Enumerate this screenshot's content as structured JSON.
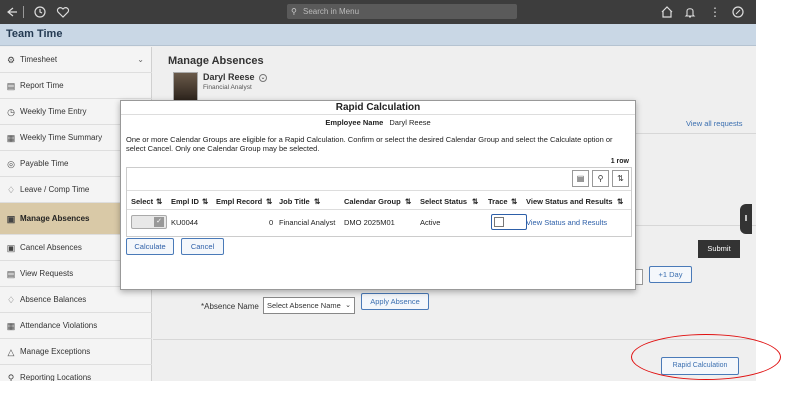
{
  "topbar": {
    "search_placeholder": "Search in Menu",
    "icons": [
      "back-icon",
      "history-icon",
      "favorites-icon",
      "home-icon",
      "notifications-icon",
      "actions-icon",
      "navbar-icon"
    ]
  },
  "app_title": "Team Time",
  "sidebar": {
    "items": [
      {
        "label": "Timesheet",
        "icon": "timesheet-icon"
      },
      {
        "label": "Report Time",
        "icon": "report-time-icon"
      },
      {
        "label": "Weekly Time Entry",
        "icon": "clock-icon"
      },
      {
        "label": "Weekly Time Summary",
        "icon": "calendar-icon"
      },
      {
        "label": "Payable Time",
        "icon": "payable-icon"
      },
      {
        "label": "Leave / Comp Time",
        "icon": "leave-icon"
      },
      {
        "label": "Manage Absences",
        "icon": "briefcase-icon"
      },
      {
        "label": "Cancel Absences",
        "icon": "cancel-icon"
      },
      {
        "label": "View Requests",
        "icon": "requests-icon"
      },
      {
        "label": "Absence Balances",
        "icon": "balance-icon"
      },
      {
        "label": "Attendance Violations",
        "icon": "violation-icon"
      },
      {
        "label": "Manage Exceptions",
        "icon": "warning-icon"
      },
      {
        "label": "Reporting Locations",
        "icon": "location-icon"
      }
    ],
    "active_index": 6
  },
  "main": {
    "title": "Manage Absences",
    "employee_name": "Daryl Reese",
    "employee_title": "Financial Analyst",
    "view_all": "View all requests",
    "submit": "Submit",
    "plus_day": "+1 Day",
    "absence_name_label": "*Absence Name",
    "absence_name_value": "Select Absence Name",
    "apply_absence": "Apply Absence",
    "rapid_calc_button": "Rapid Calculation"
  },
  "modal": {
    "title": "Rapid Calculation",
    "employee_name_label": "Employee Name",
    "employee_name_value": "Daryl Reese",
    "instructions": "One or more Calendar Groups are eligible for a Rapid Calculation.  Confirm or select the desired Calendar Group and select the Calculate option or select Cancel.  Only one Calendar Group may be selected.",
    "row_count": "1 row",
    "columns": [
      "Select",
      "Empl ID",
      "Empl Record",
      "Job Title",
      "Calendar Group",
      "Select Status",
      "Trace",
      "View Status and Results"
    ],
    "rows": [
      {
        "empl_id": "KU0044",
        "empl_record": "0",
        "job_title": "Financial Analyst",
        "calendar_group": "DMO 2025M01",
        "select_status": "Active",
        "view": "View Status and Results",
        "selected": true,
        "trace": false
      }
    ],
    "calculate": "Calculate",
    "cancel": "Cancel"
  },
  "colors": {
    "accent": "#2d5fa8",
    "active_nav": "#d9c9a7",
    "highlight": "#e01010"
  }
}
